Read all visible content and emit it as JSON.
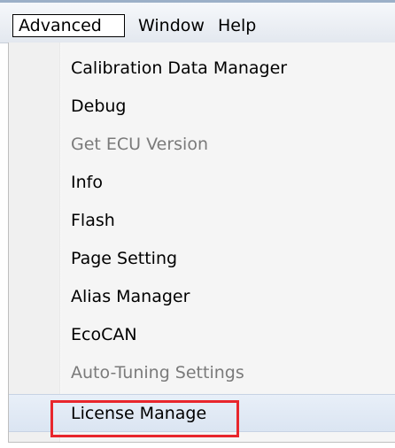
{
  "menubar": {
    "items": [
      {
        "label": "Advanced"
      },
      {
        "label": "Window"
      },
      {
        "label": "Help"
      }
    ]
  },
  "dropdown": {
    "items": [
      {
        "label": "Calibration Data Manager",
        "enabled": true
      },
      {
        "label": "Debug",
        "enabled": true
      },
      {
        "label": "Get ECU Version",
        "enabled": false
      },
      {
        "label": "Info",
        "enabled": true
      },
      {
        "label": "Flash",
        "enabled": true
      },
      {
        "label": "Page Setting",
        "enabled": true
      },
      {
        "label": "Alias Manager",
        "enabled": true
      },
      {
        "label": "EcoCAN",
        "enabled": true
      },
      {
        "label": "Auto-Tuning Settings",
        "enabled": false
      },
      {
        "label": "License Manage",
        "enabled": true,
        "highlighted": true
      }
    ]
  },
  "colors": {
    "annotation": "#e8262c",
    "disabled_text": "#7a7a7a",
    "menu_bg": "#f5f5f5"
  }
}
